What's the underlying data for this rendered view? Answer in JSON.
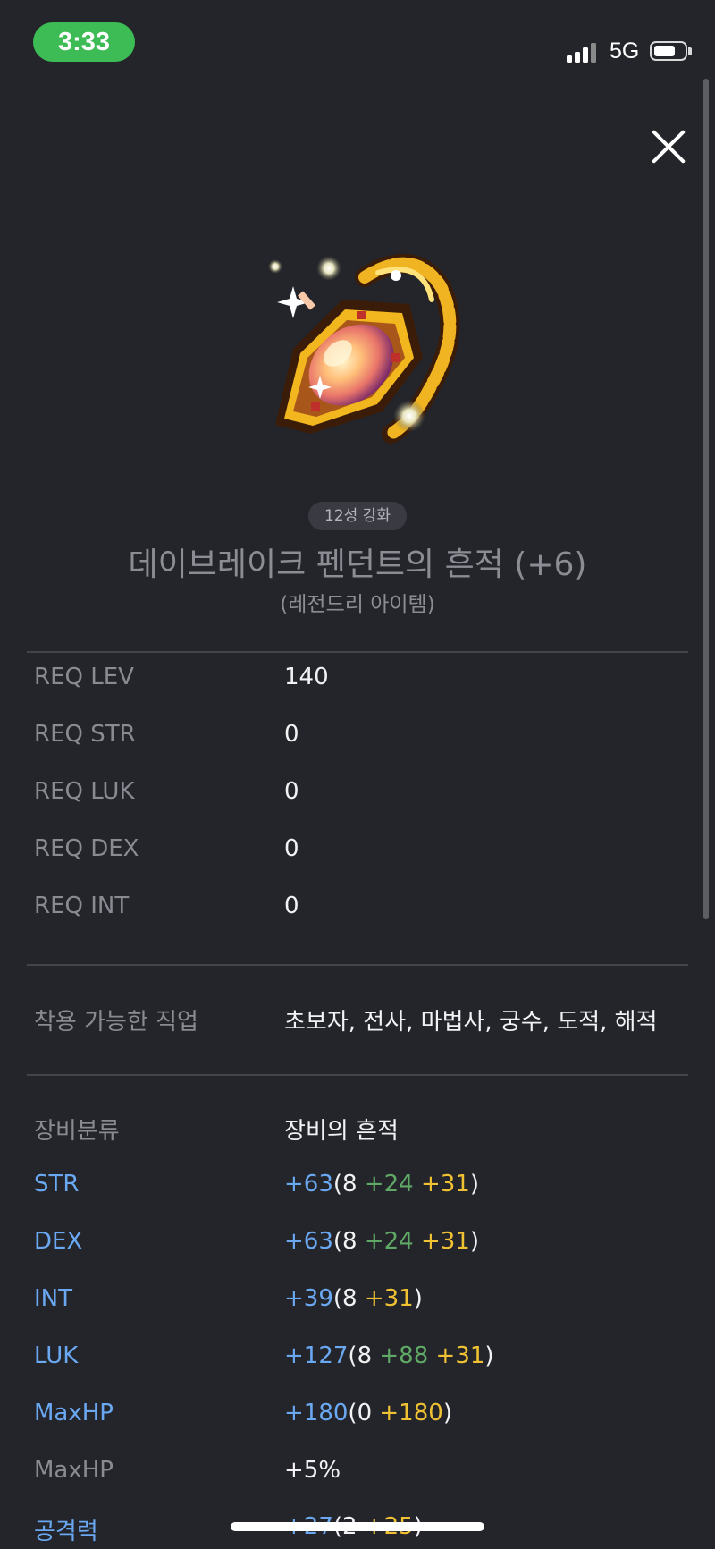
{
  "status_bar": {
    "time": "3:33",
    "network": "5G",
    "signal_bars": 4,
    "battery_level": 0.6
  },
  "header": {
    "close_icon": "close-icon"
  },
  "item": {
    "icon": "pendant-icon",
    "star_force": "12성 강화",
    "name": "데이브레이크 펜던트의 흔적 (+6)",
    "grade": "(레전드리 아이템)"
  },
  "requirements": [
    {
      "label": "REQ LEV",
      "value": "140"
    },
    {
      "label": "REQ STR",
      "value": "0"
    },
    {
      "label": "REQ LUK",
      "value": "0"
    },
    {
      "label": "REQ DEX",
      "value": "0"
    },
    {
      "label": "REQ INT",
      "value": "0"
    }
  ],
  "jobs": {
    "label": "착용 가능한 직업",
    "value": "초보자, 전사, 마법사, 궁수, 도적, 해적"
  },
  "category": {
    "label": "장비분류",
    "value": "장비의 흔적"
  },
  "stats": [
    {
      "label": "STR",
      "total": "+63",
      "open": "(",
      "base": "8",
      "add": "+24",
      "star": "+31",
      "close": ")"
    },
    {
      "label": "DEX",
      "total": "+63",
      "open": "(",
      "base": "8",
      "add": "+24",
      "star": "+31",
      "close": ")"
    },
    {
      "label": "INT",
      "total": "+39",
      "open": "(",
      "base": "8",
      "add": "",
      "star": "+31",
      "close": ")"
    },
    {
      "label": "LUK",
      "total": "+127",
      "open": "(",
      "base": "8",
      "add": "+88",
      "star": "+31",
      "close": ")"
    },
    {
      "label": "MaxHP",
      "total": "+180",
      "open": "(",
      "base": "0",
      "add": "",
      "star": "+180",
      "close": ")"
    }
  ],
  "maxhp_percent": {
    "label": "MaxHP",
    "value": "+5%"
  },
  "attack": {
    "label": "공격력",
    "total": "+27",
    "open": "(",
    "base": "2",
    "add": "",
    "star": "+25",
    "close": ")"
  },
  "colors": {
    "background": "#24252b",
    "stat_blue": "#6aa8f2",
    "bonus_green": "#5fa865",
    "starforce_yellow": "#f0c233",
    "time_pill": "#3dbb55"
  }
}
